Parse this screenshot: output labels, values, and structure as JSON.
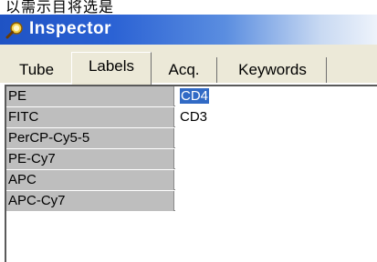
{
  "window": {
    "top_text": "以需示目将选是",
    "title": "Inspector",
    "title_icon": "magnifier-icon",
    "accent_color": "#2b62d4"
  },
  "tabs": [
    {
      "label": "Tube",
      "active": false
    },
    {
      "label": "Labels",
      "active": true
    },
    {
      "label": "Acq.",
      "active": false
    },
    {
      "label": "Keywords",
      "active": false
    }
  ],
  "grid": {
    "rows": [
      {
        "name": "PE",
        "value": "CD4",
        "selected": true
      },
      {
        "name": "FITC",
        "value": "CD3",
        "selected": false
      },
      {
        "name": "PerCP-Cy5-5",
        "value": "",
        "selected": false
      },
      {
        "name": "PE-Cy7",
        "value": "",
        "selected": false
      },
      {
        "name": "APC",
        "value": "",
        "selected": false
      },
      {
        "name": "APC-Cy7",
        "value": "",
        "selected": false
      }
    ]
  }
}
